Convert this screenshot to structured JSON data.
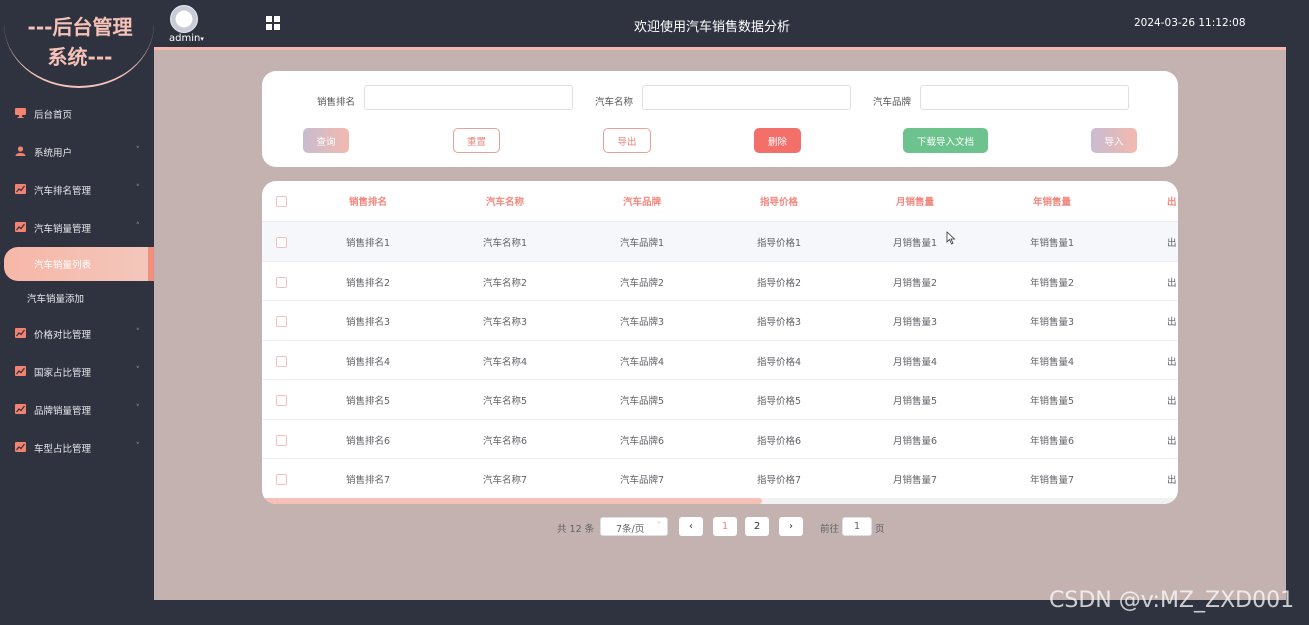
{
  "logo": {
    "line1": "---后台管理",
    "line2": "系统---"
  },
  "header": {
    "admin_name": "admin",
    "admin_caret": "▾",
    "title": "欢迎使用汽车销售数据分析",
    "datetime": "2024-03-26 11:12:08"
  },
  "sidebar": {
    "items": [
      {
        "label": "后台首页",
        "icon": "monitor-icon"
      },
      {
        "label": "系统用户",
        "icon": "user-icon",
        "arrow": "˅"
      },
      {
        "label": "汽车排名管理",
        "icon": "chart-icon",
        "arrow": "˅"
      },
      {
        "label": "汽车销量管理",
        "icon": "chart-icon",
        "arrow": "˄"
      },
      {
        "label": "价格对比管理",
        "icon": "chart-icon",
        "arrow": "˅"
      },
      {
        "label": "国家占比管理",
        "icon": "chart-icon",
        "arrow": "˅"
      },
      {
        "label": "品牌销量管理",
        "icon": "chart-icon",
        "arrow": "˅"
      },
      {
        "label": "车型占比管理",
        "icon": "chart-icon",
        "arrow": "˅"
      }
    ],
    "submenu": [
      {
        "label": "汽车销量列表",
        "active": true
      },
      {
        "label": "汽车销量添加",
        "active": false
      }
    ]
  },
  "search": {
    "fields": [
      {
        "label": "销售排名",
        "value": ""
      },
      {
        "label": "汽车名称",
        "value": ""
      },
      {
        "label": "汽车品牌",
        "value": ""
      }
    ],
    "buttons": {
      "query": "查询",
      "reset": "重置",
      "export": "导出",
      "delete": "删除",
      "download": "下载导入文档",
      "import": "导入"
    }
  },
  "table": {
    "columns": [
      "销售排名",
      "汽车名称",
      "汽车品牌",
      "指导价格",
      "月销售量",
      "年销售量",
      "出"
    ],
    "rows": [
      [
        "销售排名1",
        "汽车名称1",
        "汽车品牌1",
        "指导价格1",
        "月销售量1",
        "年销售量1",
        "出"
      ],
      [
        "销售排名2",
        "汽车名称2",
        "汽车品牌2",
        "指导价格2",
        "月销售量2",
        "年销售量2",
        "出"
      ],
      [
        "销售排名3",
        "汽车名称3",
        "汽车品牌3",
        "指导价格3",
        "月销售量3",
        "年销售量3",
        "出"
      ],
      [
        "销售排名4",
        "汽车名称4",
        "汽车品牌4",
        "指导价格4",
        "月销售量4",
        "年销售量4",
        "出"
      ],
      [
        "销售排名5",
        "汽车名称5",
        "汽车品牌5",
        "指导价格5",
        "月销售量5",
        "年销售量5",
        "出"
      ],
      [
        "销售排名6",
        "汽车名称6",
        "汽车品牌6",
        "指导价格6",
        "月销售量6",
        "年销售量6",
        "出"
      ],
      [
        "销售排名7",
        "汽车名称7",
        "汽车品牌7",
        "指导价格7",
        "月销售量7",
        "年销售量7",
        "出"
      ]
    ],
    "highlighted_row": 0
  },
  "pagination": {
    "total_text": "共 12 条",
    "page_size": "7条/页",
    "prev": "‹",
    "next": "›",
    "pages": [
      "1",
      "2"
    ],
    "current_page": "1",
    "goto_label": "前往",
    "goto_value": "1",
    "page_suffix": "页"
  },
  "watermark": "CSDN @v:MZ_ZXD001",
  "colors": {
    "accent": "#f08a80",
    "sidebar_bg": "#2f3340",
    "main_bg": "#c3b2b0",
    "delete": "#f26f6a",
    "download": "#6dc38e"
  }
}
